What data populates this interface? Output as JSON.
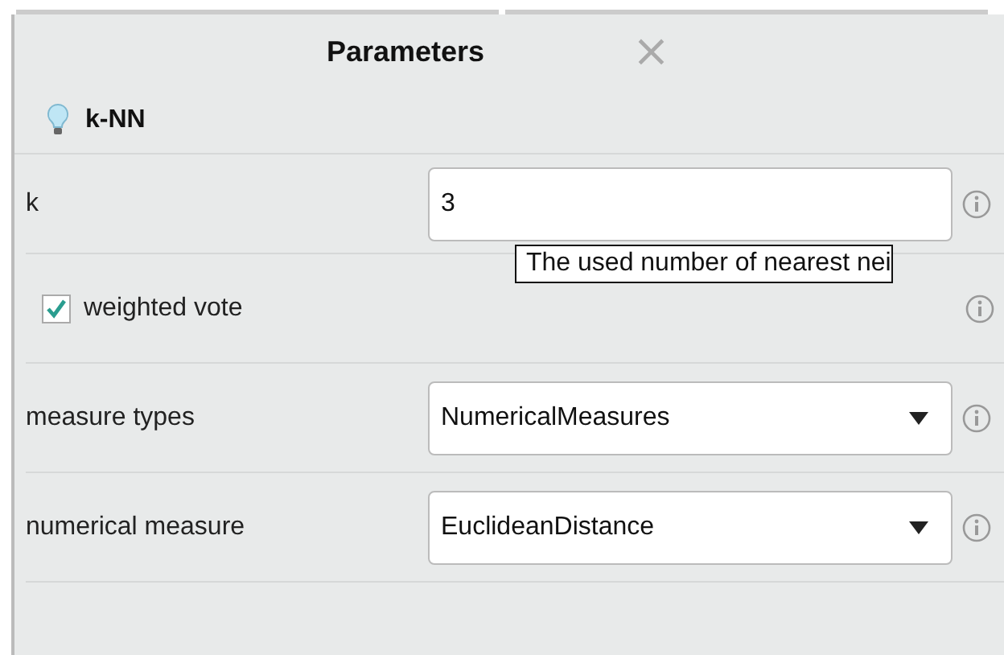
{
  "panel": {
    "title": "Parameters",
    "close": "×"
  },
  "operator": {
    "name": "k-NN"
  },
  "parameters": [
    {
      "kind": "text",
      "label": "k",
      "value": "3",
      "tooltip": "The used number of nearest nei"
    },
    {
      "kind": "checkbox",
      "label": "weighted vote",
      "checked": true
    },
    {
      "kind": "select",
      "label": "measure types",
      "value": "NumericalMeasures"
    },
    {
      "kind": "select",
      "label": "numerical measure",
      "value": "EuclideanDistance"
    }
  ]
}
